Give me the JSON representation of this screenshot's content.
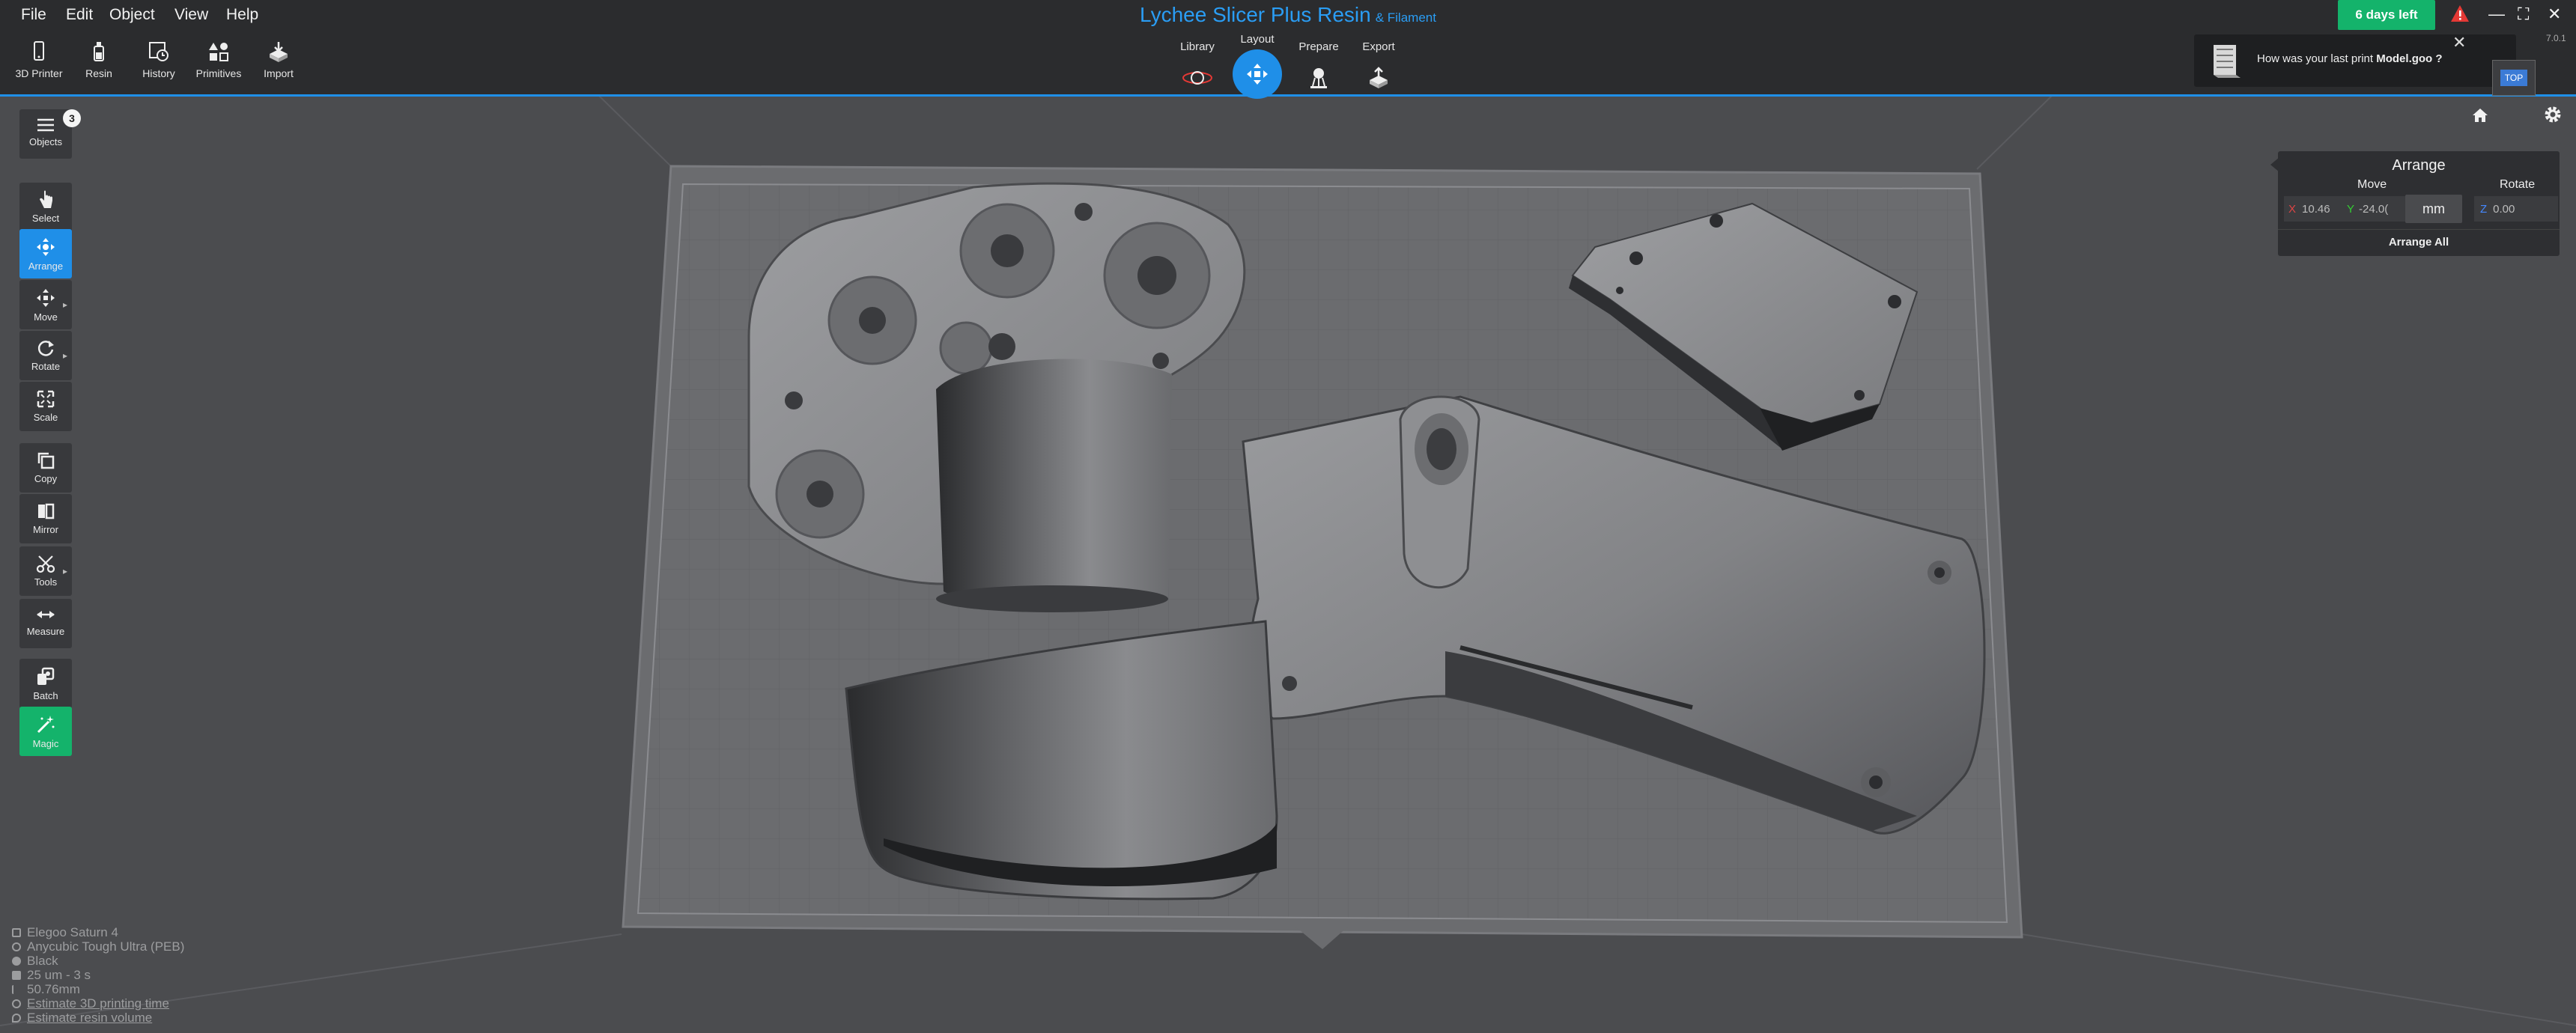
{
  "menu": [
    "File",
    "Edit",
    "Object",
    "View",
    "Help"
  ],
  "app": {
    "title": "Lychee Slicer Plus Resin",
    "subtitle": "& Filament",
    "version": "7.0.1"
  },
  "trial": "6 days left",
  "toolbar": [
    "3D Printer",
    "Resin",
    "History",
    "Primitives",
    "Import"
  ],
  "steps": [
    "Library",
    "Layout",
    "Prepare",
    "Export"
  ],
  "notification": {
    "prefix": "How was your last print",
    "file": "Model.goo ?"
  },
  "view_cube": "TOP",
  "sidebar": {
    "objects": "Objects",
    "objects_count": "3",
    "tools": [
      "Select",
      "Arrange",
      "Move",
      "Rotate",
      "Scale",
      "Copy",
      "Mirror",
      "Tools",
      "Measure",
      "Batch",
      "Magic"
    ]
  },
  "arrange": {
    "title": "Arrange",
    "move_label": "Move",
    "rotate_label": "Rotate",
    "x_axis": "X",
    "x": "10.46",
    "y_axis": "Y",
    "y": "-24.0(",
    "unit": "mm",
    "z_axis": "Z",
    "rotate_value": "0.00",
    "arrange_all": "Arrange All"
  },
  "info": {
    "printer": "Elegoo Saturn 4",
    "resin": "Anycubic Tough Ultra (PEB)",
    "color": "Black",
    "layer": "25 um - 3 s",
    "height": "50.76mm",
    "estimate_time": "Estimate 3D printing time",
    "estimate_volume": "Estimate resin volume"
  }
}
